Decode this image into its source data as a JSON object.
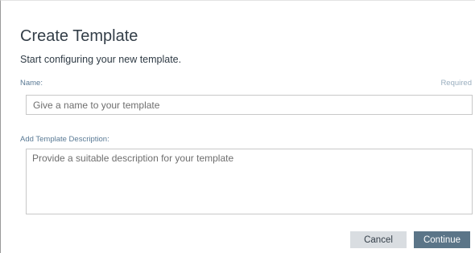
{
  "dialog": {
    "title": "Create Template",
    "subtitle": "Start configuring your new template."
  },
  "form": {
    "name": {
      "label": "Name:",
      "required_label": "Required",
      "placeholder": "Give a name to your template",
      "value": ""
    },
    "description": {
      "label": "Add Template Description:",
      "placeholder": "Provide a suitable description for your template",
      "value": ""
    }
  },
  "actions": {
    "cancel_label": "Cancel",
    "continue_label": "Continue"
  },
  "colors": {
    "primary_button": "#5b7588",
    "secondary_button": "#d9dde1",
    "label_text": "#5a7a95",
    "title_text": "#333e48"
  }
}
